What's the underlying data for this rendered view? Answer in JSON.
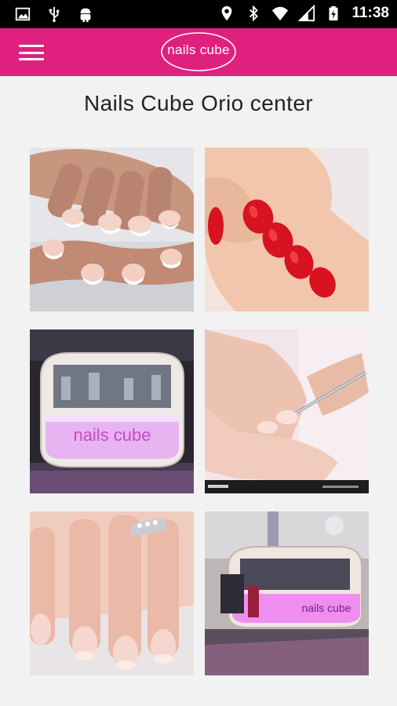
{
  "status_bar": {
    "time": "11:38",
    "left_icons": [
      "image-icon",
      "usb-icon",
      "android-icon"
    ],
    "right_icons": [
      "location-icon",
      "bluetooth-icon",
      "wifi-icon",
      "signal-icon",
      "battery-charging-icon"
    ]
  },
  "app_bar": {
    "menu_icon": "hamburger-menu-icon",
    "logo_text": "nails cube",
    "color": "#e0207f"
  },
  "page": {
    "title": "Nails Cube Orio center"
  },
  "gallery": {
    "photos": [
      {
        "subject": "french-manicure-photo"
      },
      {
        "subject": "red-nail-polish-photo"
      },
      {
        "subject": "nails-cube-kiosk-photo",
        "sign_text": "nails cube"
      },
      {
        "subject": "cuticle-care-photo"
      },
      {
        "subject": "natural-nails-ring-photo"
      },
      {
        "subject": "mall-kiosk-photo",
        "sign_text": "nails cube"
      }
    ]
  }
}
